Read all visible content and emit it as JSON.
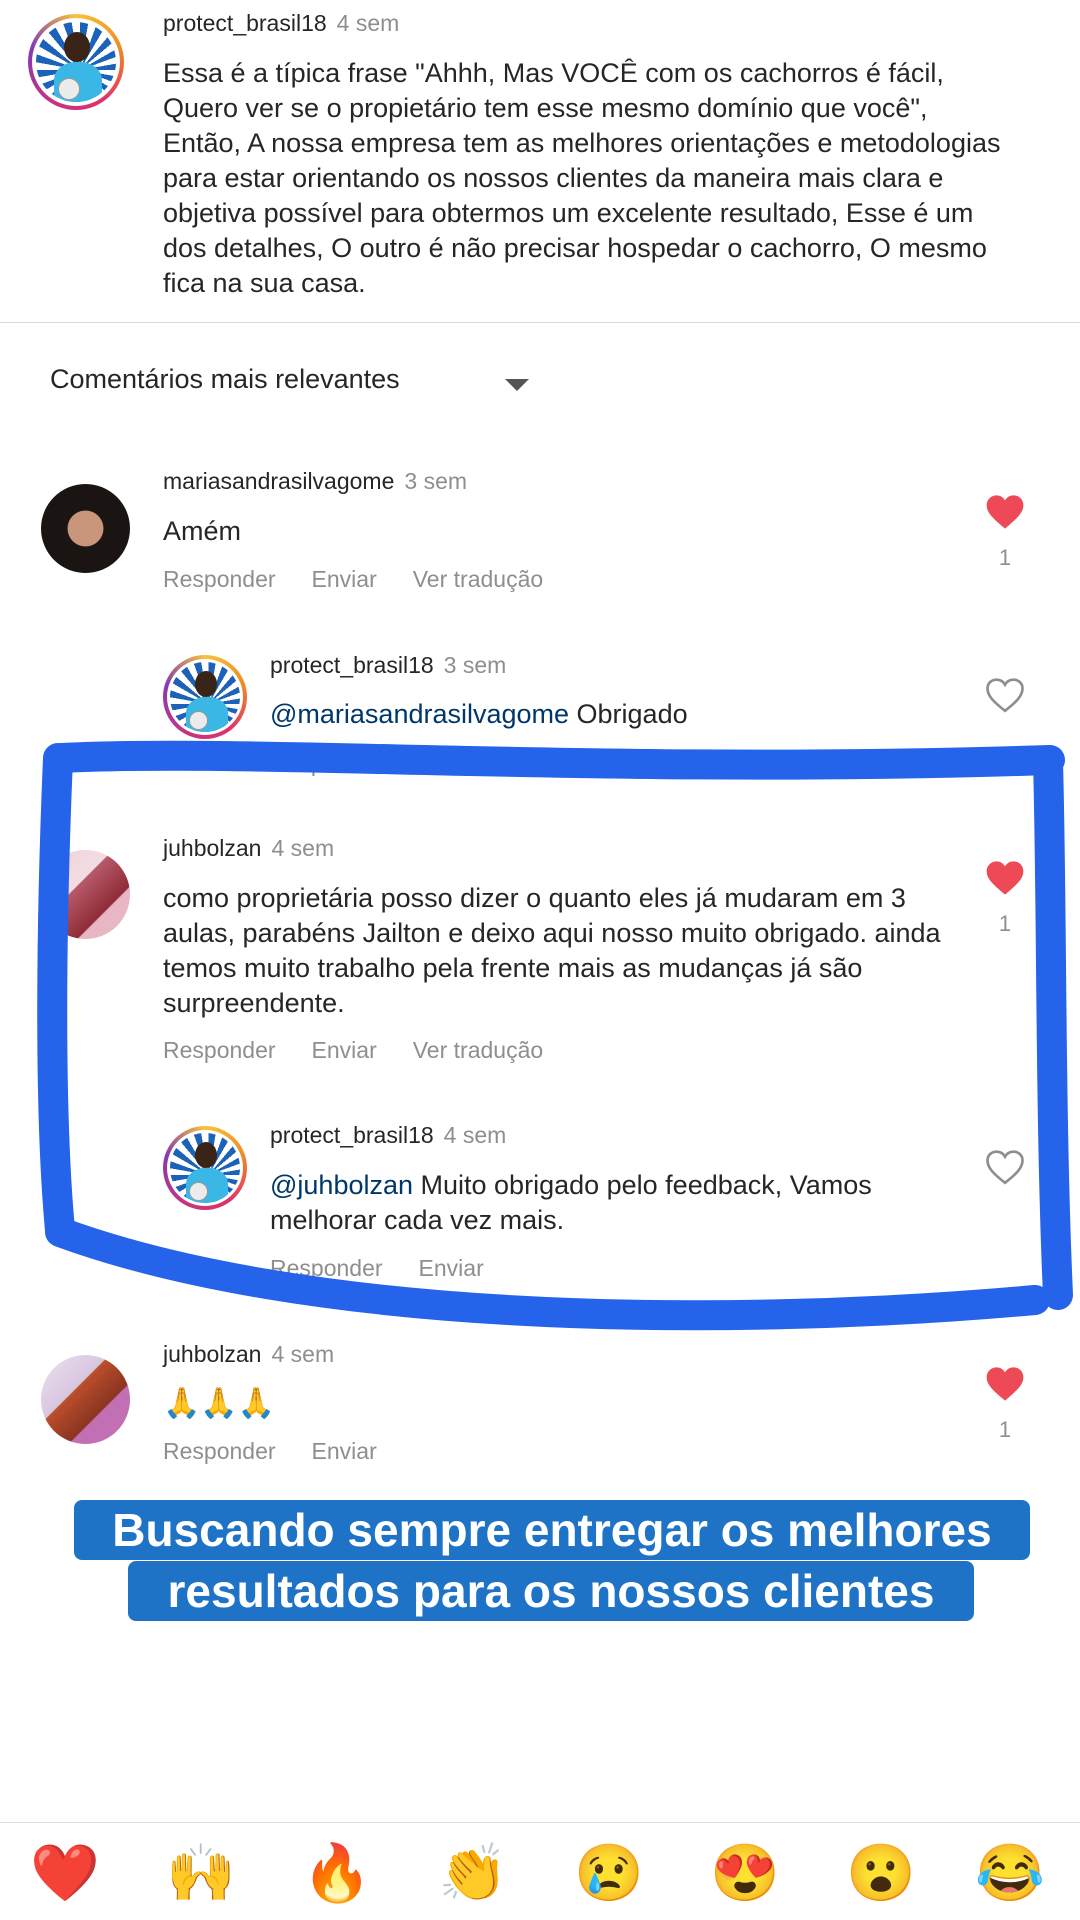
{
  "caption": {
    "username": "protect_brasil18",
    "time": "4 sem",
    "text": "Essa é a típica frase \"Ahhh, Mas VOCÊ com os cachorros é fácil, Quero ver se o propietário tem esse mesmo domínio que você\", Então, A nossa empresa tem as melhores orientações e metodologias para estar orientando os nossos clientes da maneira mais clara e objetiva possível para obtermos um excelente resultado, Esse é um dos detalhes, O outro é não precisar hospedar o cachorro, O mesmo fica na sua casa."
  },
  "sort": {
    "label": "Comentários mais relevantes"
  },
  "comments": [
    {
      "username": "mariasandrasilvagome",
      "time": "3 sem",
      "text": "Amém",
      "actions": [
        "Responder",
        "Enviar",
        "Ver tradução"
      ],
      "likes": "1",
      "liked": true
    },
    {
      "username": "protect_brasil18",
      "time": "3 sem",
      "mention": "@mariasandrasilvagome",
      "text": " Obrigado",
      "actions": [
        "Responder",
        "Enviar"
      ],
      "liked": false
    },
    {
      "username": "juhbolzan",
      "time": "4 sem",
      "text": "como proprietária posso dizer o quanto eles já mudaram em 3 aulas, parabéns Jailton e deixo aqui nosso muito obrigado.  ainda temos muito trabalho pela frente mais as mudanças já são surpreendente.",
      "actions": [
        "Responder",
        "Enviar",
        "Ver tradução"
      ],
      "likes": "1",
      "liked": true
    },
    {
      "username": "protect_brasil18",
      "time": "4 sem",
      "mention": "@juhbolzan",
      "text": " Muito obrigado pelo feedback, Vamos melhorar cada vez mais.",
      "actions": [
        "Responder",
        "Enviar"
      ],
      "liked": false
    },
    {
      "username": "juhbolzan",
      "time": "4 sem",
      "text": "🙏🙏🙏",
      "actions": [
        "Responder",
        "Enviar"
      ],
      "likes": "1",
      "liked": true
    }
  ],
  "banner": {
    "line1": "Buscando sempre entregar os melhores",
    "line2": "resultados para os nossos clientes"
  },
  "emoji_bar": [
    "❤️",
    "🙌",
    "🔥",
    "👏",
    "😢",
    "😍",
    "😮",
    "😂"
  ],
  "colors": {
    "like_red": "#ed4956",
    "mention_blue": "#00376b",
    "highlight_blue": "#2563eb",
    "banner_blue": "#1f73c6"
  },
  "icons": {
    "liked": "heart-filled-icon",
    "unliked": "heart-outline-icon",
    "sort": "caret-down-icon"
  }
}
